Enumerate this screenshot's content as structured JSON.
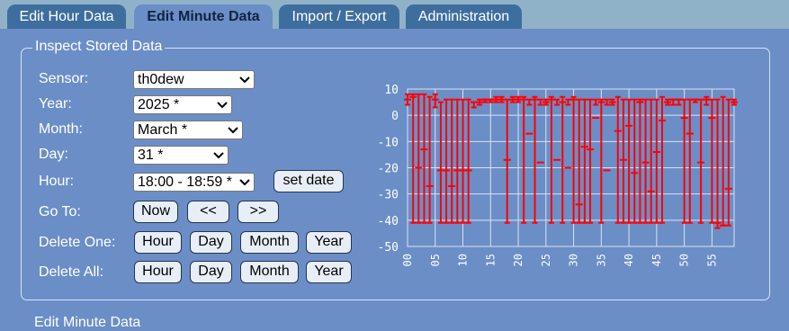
{
  "tabs": [
    {
      "label": "Edit Hour Data",
      "active": false
    },
    {
      "label": "Edit Minute Data",
      "active": true
    },
    {
      "label": "Import / Export",
      "active": false
    },
    {
      "label": "Administration",
      "active": false
    }
  ],
  "inspect": {
    "legend": "Inspect Stored Data",
    "sensor_label": "Sensor:",
    "sensor_value": "th0dew",
    "year_label": "Year:",
    "year_value": "2025 *",
    "month_label": "Month:",
    "month_value": "March *",
    "day_label": "Day:",
    "day_value": "31 *",
    "hour_label": "Hour:",
    "hour_value": "18:00 - 18:59 *",
    "set_date_label": "set date",
    "goto_label": "Go To:",
    "now_label": "Now",
    "prev_label": "<<",
    "next_label": ">>",
    "delete_one_label": "Delete One:",
    "delete_all_label": "Delete All:",
    "unit_buttons": [
      "Hour",
      "Day",
      "Month",
      "Year"
    ]
  },
  "section2_title": "Edit Minute Data",
  "colors": {
    "background": "#6b8ec7",
    "tab": "#3e6e9e",
    "series": "#ff0000",
    "grid": "#dbe3ee"
  },
  "icons": {
    "dropdown": "chevron-down-icon"
  },
  "chart_data": {
    "type": "line",
    "chart_style": "range bars (min/avg/max per minute)",
    "xlim": [
      0,
      59
    ],
    "ylim": [
      -50,
      10
    ],
    "y_ticks": [
      10,
      0,
      -10,
      -20,
      -30,
      -40,
      -50
    ],
    "x_ticks": [
      "00",
      "05",
      "10",
      "15",
      "20",
      "25",
      "30",
      "35",
      "40",
      "45",
      "50",
      "55"
    ],
    "grid": true,
    "series": [
      {
        "minutes": [
          0,
          1,
          2,
          3,
          4,
          5,
          6,
          7,
          8,
          9,
          10,
          11,
          12,
          13,
          14,
          15,
          16,
          17,
          18,
          19,
          20,
          21,
          22,
          23,
          24,
          25,
          26,
          27,
          28,
          29,
          30,
          31,
          32,
          33,
          34,
          35,
          36,
          37,
          38,
          39,
          40,
          41,
          42,
          43,
          44,
          45,
          46,
          47,
          48,
          49,
          50,
          51,
          52,
          53,
          54,
          55,
          56,
          57,
          58,
          59
        ],
        "min": [
          4,
          -41,
          -41,
          -41,
          -41,
          3,
          -41,
          -41,
          -41,
          -41,
          -41,
          -41,
          3,
          4,
          5,
          5,
          5,
          5,
          -41,
          5,
          5,
          -41,
          4,
          -41,
          4,
          4,
          -41,
          4,
          -41,
          4,
          -41,
          -41,
          -41,
          -41,
          4,
          -41,
          4,
          4,
          -41,
          -41,
          -41,
          -41,
          -41,
          -41,
          -41,
          -41,
          -41,
          4,
          4,
          4,
          -41,
          -41,
          5,
          -41,
          4,
          -41,
          -43,
          -42,
          -42,
          4
        ],
        "avg": [
          6,
          7,
          -20,
          -13,
          -27,
          6,
          -21,
          -21,
          -27,
          -21,
          -21,
          -21,
          5,
          5,
          6,
          6,
          6,
          6,
          -17,
          6,
          6,
          6,
          -7,
          6,
          -18,
          5,
          6,
          -17,
          5,
          -20,
          6,
          -34,
          -12,
          -13,
          -1,
          5,
          -21,
          5,
          -6,
          -17,
          -4,
          -22,
          5,
          -18,
          -29,
          -14,
          -2,
          5,
          6,
          6,
          -1,
          -7,
          6,
          -18,
          6,
          -1,
          -41,
          -42,
          -28,
          5
        ],
        "max": [
          8,
          8,
          8,
          8,
          7,
          8,
          5,
          6,
          6,
          6,
          6,
          6,
          5,
          6,
          6,
          6,
          7,
          7,
          6,
          7,
          7,
          7,
          6,
          7,
          6,
          6,
          7,
          6,
          7,
          6,
          7,
          6,
          6,
          6,
          6,
          6,
          6,
          6,
          7,
          6,
          6,
          6,
          6,
          6,
          6,
          6,
          7,
          6,
          6,
          6,
          6,
          6,
          6,
          6,
          7,
          6,
          6,
          7,
          6,
          6
        ]
      }
    ]
  }
}
